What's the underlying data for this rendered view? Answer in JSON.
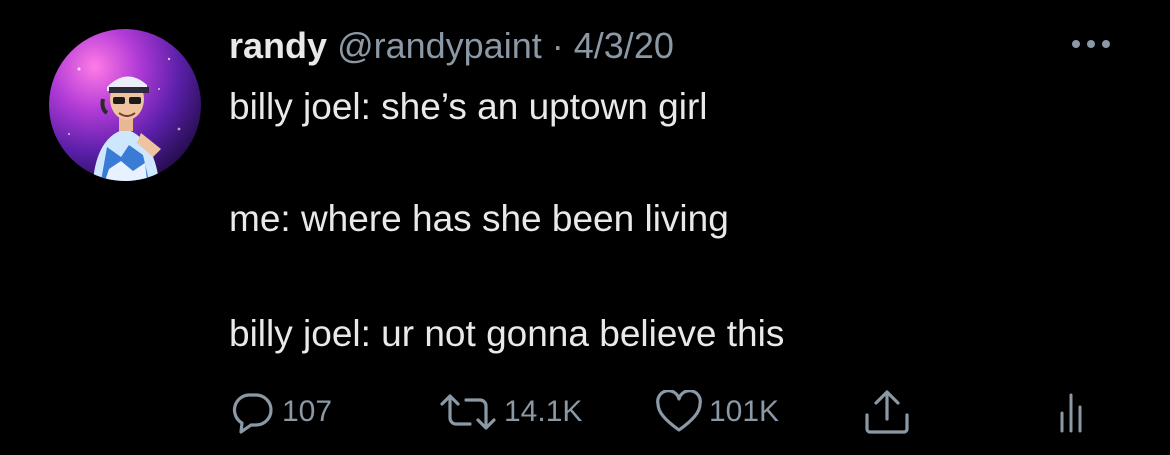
{
  "tweet": {
    "name": "randy",
    "handle": "@randypaint",
    "separator": "·",
    "date": "4/3/20",
    "lines": [
      "billy joel: she’s an uptown girl",
      "me: where has she been living",
      "billy joel: ur not gonna believe this"
    ]
  },
  "actions": {
    "reply_count": "107",
    "retweet_count": "14.1K",
    "like_count": "101K"
  },
  "icons": {
    "avatar": "avatar-photo",
    "more": "more-icon",
    "reply": "reply-icon",
    "retweet": "retweet-icon",
    "like": "heart-icon",
    "share": "share-icon",
    "analytics": "analytics-icon"
  },
  "colors": {
    "background": "#000000",
    "primary_text": "#e7e9ea",
    "secondary_text": "#8b98a5"
  }
}
